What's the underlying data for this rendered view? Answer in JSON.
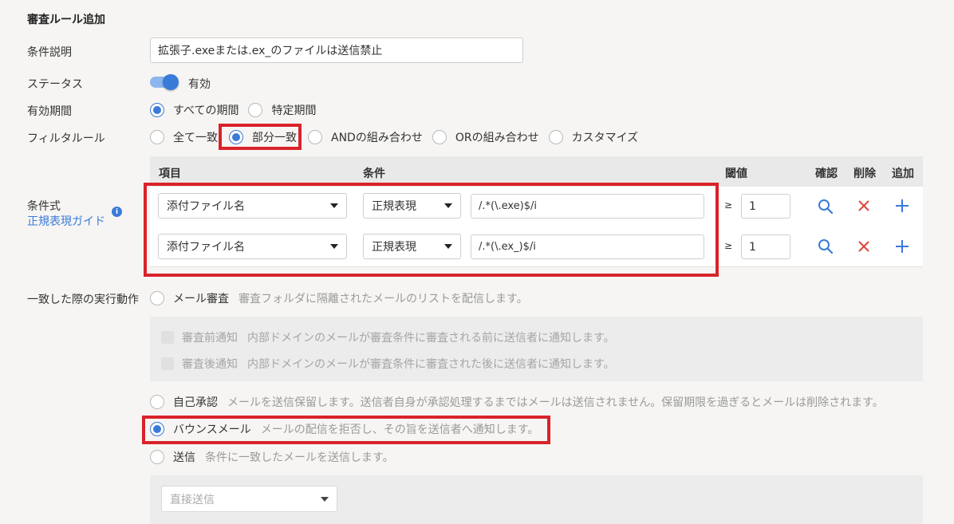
{
  "page_title": "審査ルール追加",
  "fields": {
    "description": {
      "label": "条件説明",
      "value": "拡張子.exeまたは.ex_のファイルは送信禁止"
    },
    "status": {
      "label": "ステータス",
      "value": "有効"
    },
    "period": {
      "label": "有効期間",
      "options": [
        "すべての期間",
        "特定期間"
      ]
    },
    "filter": {
      "label": "フィルタルール",
      "options": [
        "全て一致",
        "部分一致",
        "ANDの組み合わせ",
        "ORの組み合わせ",
        "カスタマイズ"
      ]
    },
    "expression": {
      "label": "条件式",
      "guide_link": "正規表現ガイド"
    }
  },
  "table": {
    "headers": {
      "item": "項目",
      "condition": "条件",
      "threshold": "閾値",
      "confirm": "確認",
      "delete": "削除",
      "add": "追加"
    },
    "rows": [
      {
        "item": "添付ファイル名",
        "condition": "正規表現",
        "pattern": "/.*(\\.exe)$/i",
        "ge": "≥",
        "threshold": "1"
      },
      {
        "item": "添付ファイル名",
        "condition": "正規表現",
        "pattern": "/.*(\\.ex_)$/i",
        "ge": "≥",
        "threshold": "1"
      }
    ]
  },
  "actions": {
    "label": "一致した際の実行動作",
    "review": {
      "label": "メール審査",
      "desc": "審査フォルダに隔離されたメールのリストを配信します。"
    },
    "pre_notify": {
      "label": "審査前通知",
      "desc": "内部ドメインのメールが審査条件に審査される前に送信者に通知します。"
    },
    "post_notify": {
      "label": "審査後通知",
      "desc": "内部ドメインのメールが審査条件に審査された後に送信者に通知します。"
    },
    "self_approve": {
      "label": "自己承認",
      "desc": "メールを送信保留します。送信者自身が承認処理するまではメールは送信されません。保留期限を過ぎるとメールは削除されます。"
    },
    "bounce": {
      "label": "バウンスメール",
      "desc": "メールの配信を拒否し、その旨を送信者へ通知します。"
    },
    "send": {
      "label": "送信",
      "desc": "条件に一致したメールを送信します。"
    },
    "send_method": "直接送信"
  },
  "colors": {
    "accent": "#3a7ad9",
    "highlight": "#d9232a",
    "delete": "#e0453a"
  }
}
